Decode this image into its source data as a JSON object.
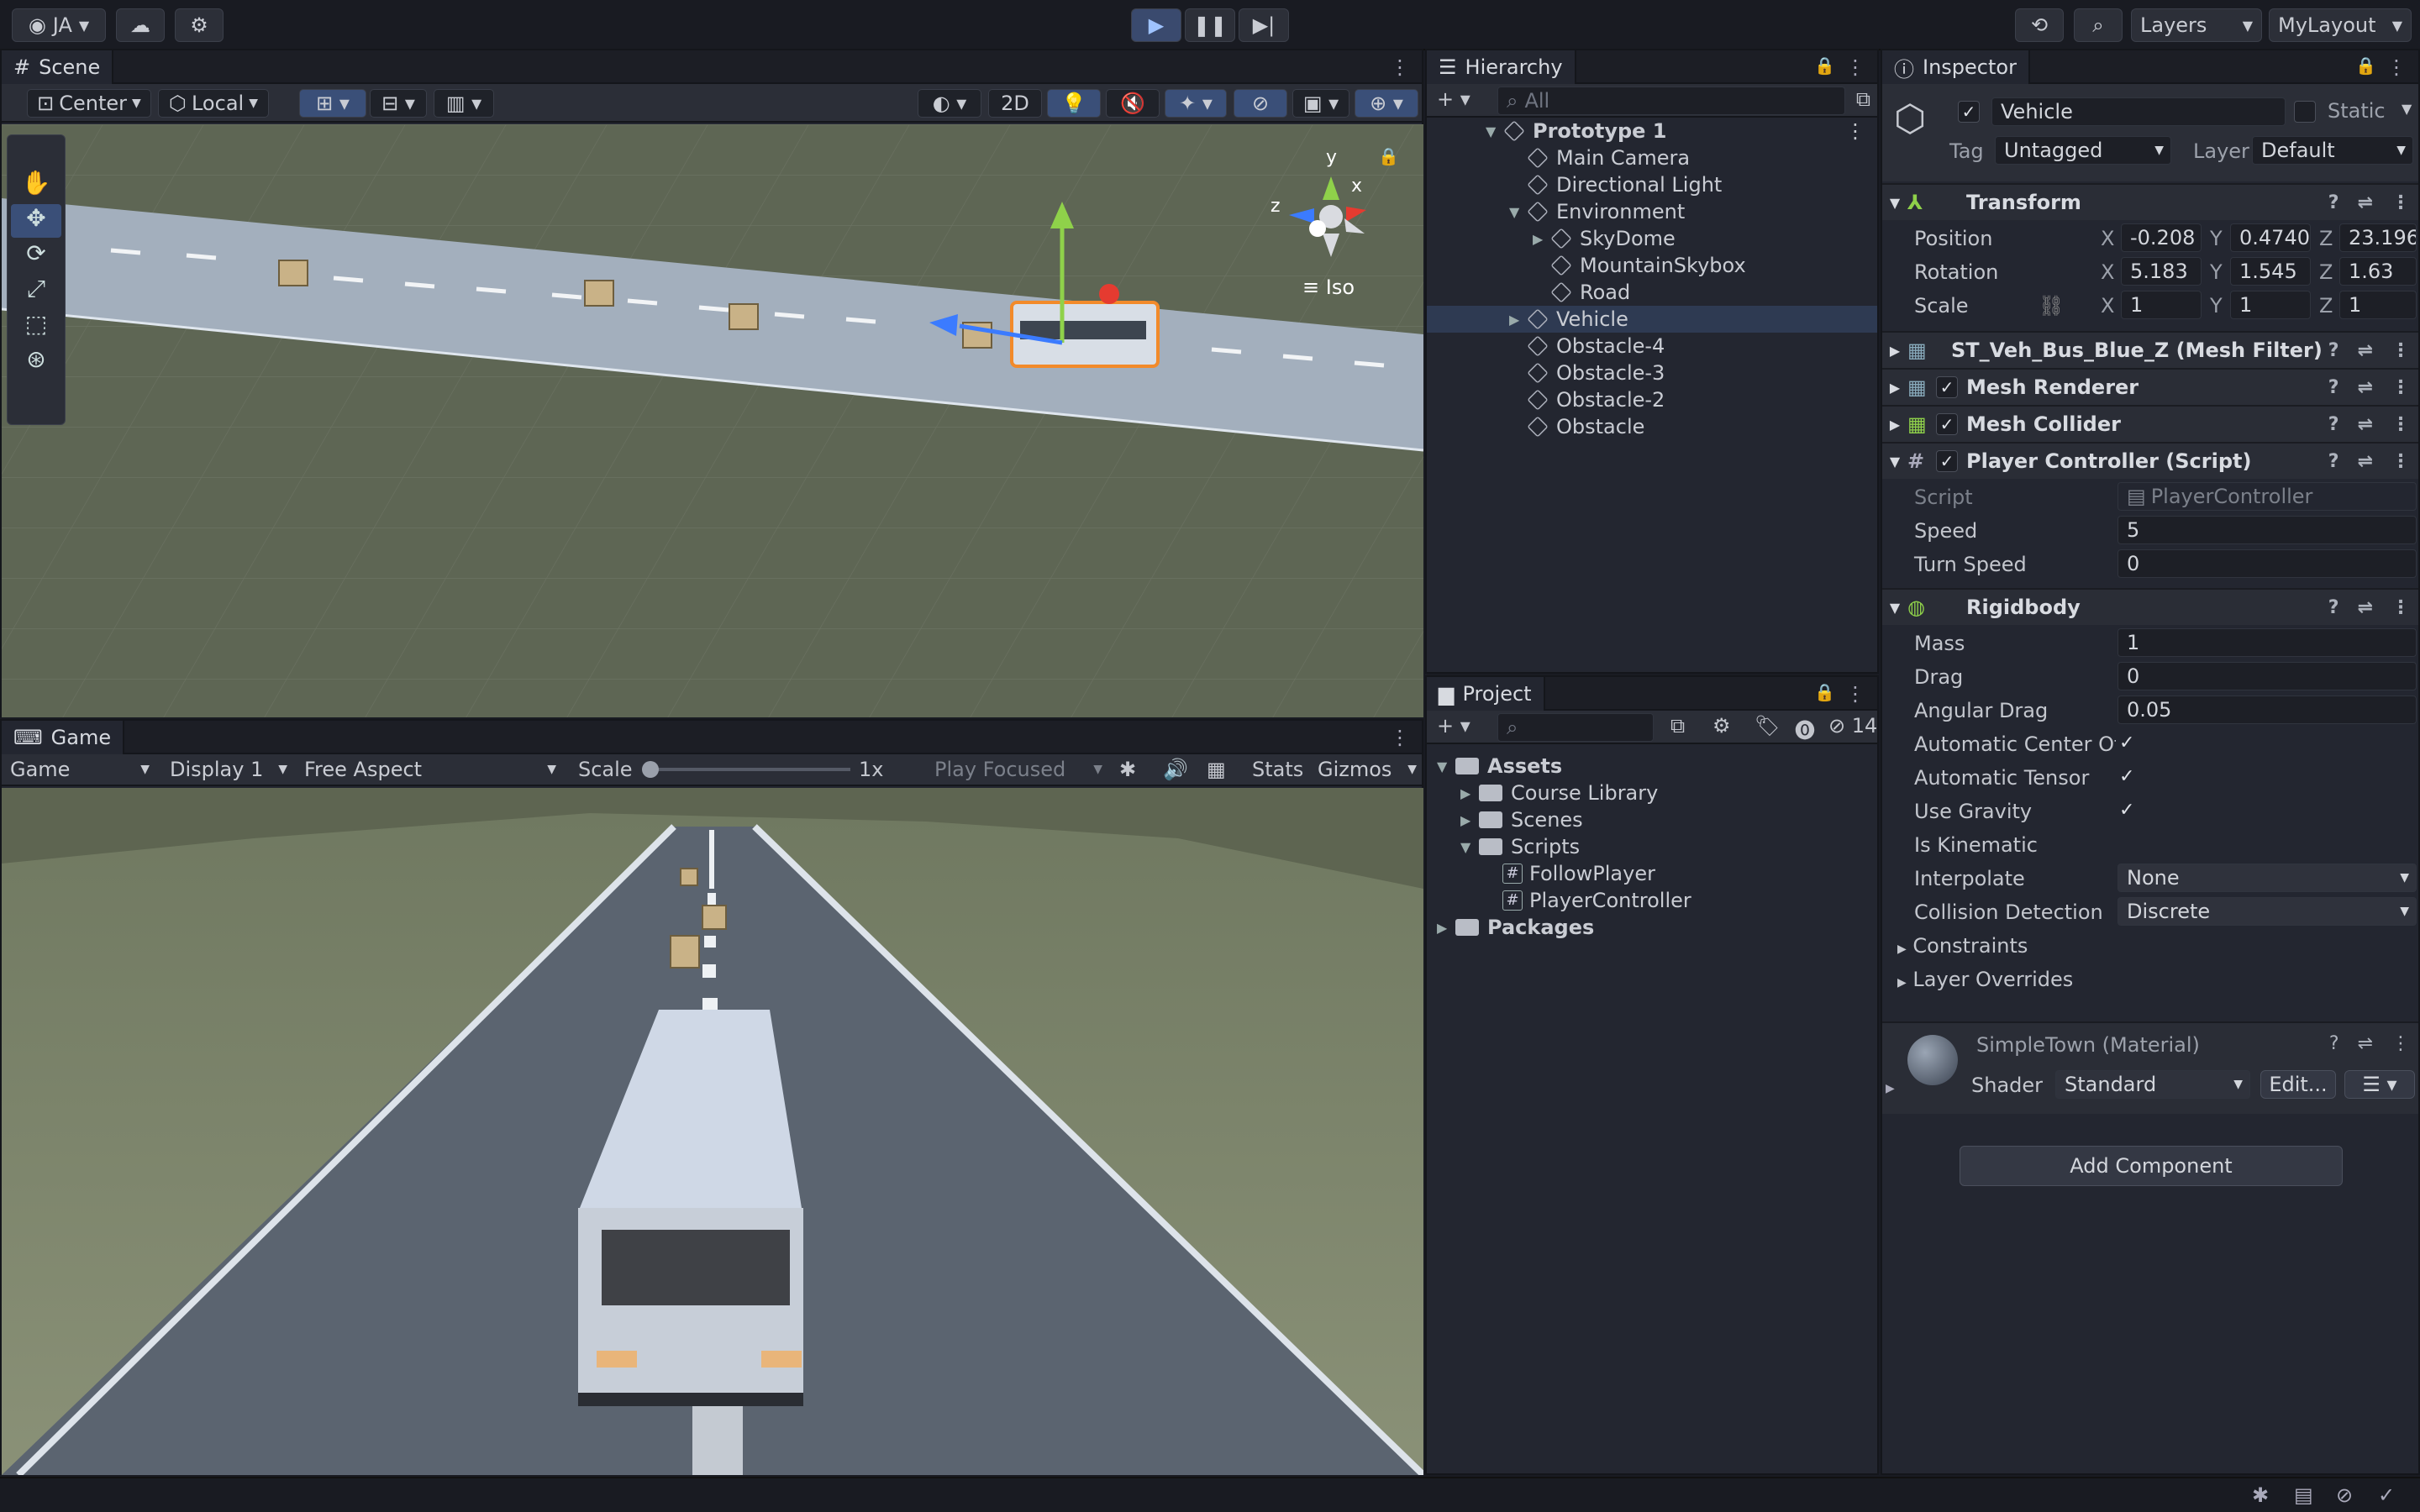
{
  "topbar": {
    "account_label": "JA",
    "layers_label": "Layers",
    "layout_label": "MyLayout"
  },
  "scene": {
    "tab_label": "Scene",
    "pivot_mode": "Center",
    "pivot_space": "Local",
    "mode_2d": "2D",
    "gizmo_view_label": "Iso",
    "axis_y": "y",
    "axis_x": "x",
    "axis_z": "z"
  },
  "game": {
    "tab_label": "Game",
    "view_select": "Game",
    "display_select": "Display 1",
    "aspect_select": "Free Aspect",
    "scale_label": "Scale",
    "scale_value": "1x",
    "scale_fraction": 0.0,
    "play_focus_select": "Play Focused",
    "stats_label": "Stats",
    "gizmos_label": "Gizmos"
  },
  "hierarchy": {
    "tab_label": "Hierarchy",
    "search_placeholder": "All",
    "items": [
      {
        "label": "Prototype 1",
        "indent": 0,
        "expanded": "open",
        "bold": true,
        "icon": "unity-scene-icon"
      },
      {
        "label": "Main Camera",
        "indent": 1,
        "icon": "gameobject-cube-icon"
      },
      {
        "label": "Directional Light",
        "indent": 1,
        "icon": "gameobject-cube-icon"
      },
      {
        "label": "Environment",
        "indent": 1,
        "expanded": "open",
        "icon": "gameobject-cube-icon"
      },
      {
        "label": "SkyDome",
        "indent": 2,
        "expanded": "closed",
        "icon": "gameobject-cube-icon"
      },
      {
        "label": "MountainSkybox",
        "indent": 2,
        "icon": "gameobject-cube-icon"
      },
      {
        "label": "Road",
        "indent": 2,
        "icon": "gameobject-cube-icon"
      },
      {
        "label": "Vehicle",
        "indent": 1,
        "expanded": "closed",
        "selected": true,
        "icon": "gameobject-cube-icon"
      },
      {
        "label": "Obstacle-4",
        "indent": 1,
        "icon": "gameobject-cube-icon"
      },
      {
        "label": "Obstacle-3",
        "indent": 1,
        "icon": "gameobject-cube-icon"
      },
      {
        "label": "Obstacle-2",
        "indent": 1,
        "icon": "gameobject-cube-icon"
      },
      {
        "label": "Obstacle",
        "indent": 1,
        "icon": "gameobject-cube-icon"
      }
    ]
  },
  "project": {
    "tab_label": "Project",
    "hidden_count": "14",
    "items": [
      {
        "label": "Assets",
        "indent": 0,
        "expanded": "open",
        "bold": true,
        "icon": "folder-icon"
      },
      {
        "label": "Course Library",
        "indent": 1,
        "expanded": "closed",
        "icon": "folder-icon"
      },
      {
        "label": "Scenes",
        "indent": 1,
        "expanded": "closed",
        "icon": "folder-icon"
      },
      {
        "label": "Scripts",
        "indent": 1,
        "expanded": "open",
        "icon": "folder-open-icon"
      },
      {
        "label": "FollowPlayer",
        "indent": 2,
        "icon": "csharp-script-icon"
      },
      {
        "label": "PlayerController",
        "indent": 2,
        "icon": "csharp-script-icon"
      },
      {
        "label": "Packages",
        "indent": 0,
        "expanded": "closed",
        "bold": true,
        "icon": "folder-icon"
      }
    ]
  },
  "inspector": {
    "tab_label": "Inspector",
    "object_name": "Vehicle",
    "static_label": "Static",
    "tag_label": "Tag",
    "tag_value": "Untagged",
    "layer_label": "Layer",
    "layer_value": "Default",
    "transform": {
      "title": "Transform",
      "position_label": "Position",
      "rotation_label": "Rotation",
      "scale_label": "Scale",
      "x": "X",
      "y": "Y",
      "z": "Z",
      "pos_x": "-0.208",
      "pos_y": "0.4740",
      "pos_z": "23.196",
      "rot_x": "5.183",
      "rot_y": "1.545",
      "rot_z": "1.63",
      "scl_x": "1",
      "scl_y": "1",
      "scl_z": "1"
    },
    "mesh_filter_title": "ST_Veh_Bus_Blue_Z (Mesh Filter)",
    "mesh_renderer_title": "Mesh Renderer",
    "mesh_collider_title": "Mesh Collider",
    "player_controller": {
      "title": "Player Controller (Script)",
      "script_label": "Script",
      "script_value": "PlayerController",
      "speed_label": "Speed",
      "speed_value": "5",
      "turn_speed_label": "Turn Speed",
      "turn_speed_value": "0"
    },
    "rigidbody": {
      "title": "Rigidbody",
      "mass_label": "Mass",
      "mass_value": "1",
      "drag_label": "Drag",
      "drag_value": "0",
      "angular_drag_label": "Angular Drag",
      "angular_drag_value": "0.05",
      "auto_center_label": "Automatic Center Of I",
      "auto_tensor_label": "Automatic Tensor",
      "use_gravity_label": "Use Gravity",
      "is_kinematic_label": "Is Kinematic",
      "interpolate_label": "Interpolate",
      "interpolate_value": "None",
      "collision_label": "Collision Detection",
      "collision_value": "Discrete",
      "constraints_label": "Constraints",
      "layer_overrides_label": "Layer Overrides"
    },
    "material": {
      "title": "SimpleTown (Material)",
      "shader_label": "Shader",
      "shader_value": "Standard",
      "edit_label": "Edit..."
    },
    "add_component_label": "Add Component"
  }
}
